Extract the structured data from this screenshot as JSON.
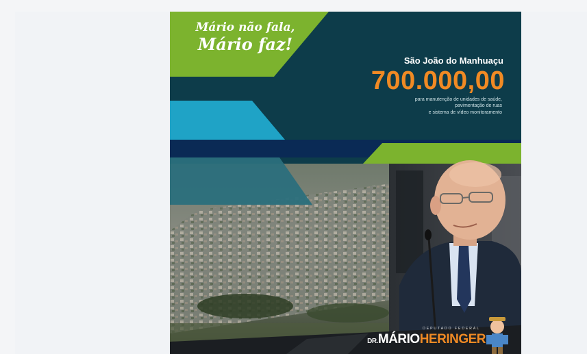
{
  "poster": {
    "slogan_line1": "Mário não fala,",
    "slogan_line2": "Mário faz!",
    "city": "São João do Manhuaçu",
    "amount": "700.000,00",
    "description_lines": [
      "para manutenção de unidades de saúde,",
      "pavimentação de ruas",
      "e sistema de vídeo monitoramento"
    ],
    "brand": {
      "prefix": "DR.",
      "first": "MÁRIO",
      "last": "HERINGER",
      "subtitle": "DEPUTADO FEDERAL"
    }
  },
  "colors": {
    "page_bg": "#f4f5f7",
    "poster_bg": "#0d3c4a",
    "green": "#7cb32e",
    "cyan": "#1fa3c6",
    "navy": "#0a2a55",
    "teal": "#2b6f7c",
    "orange": "#f08a24"
  }
}
